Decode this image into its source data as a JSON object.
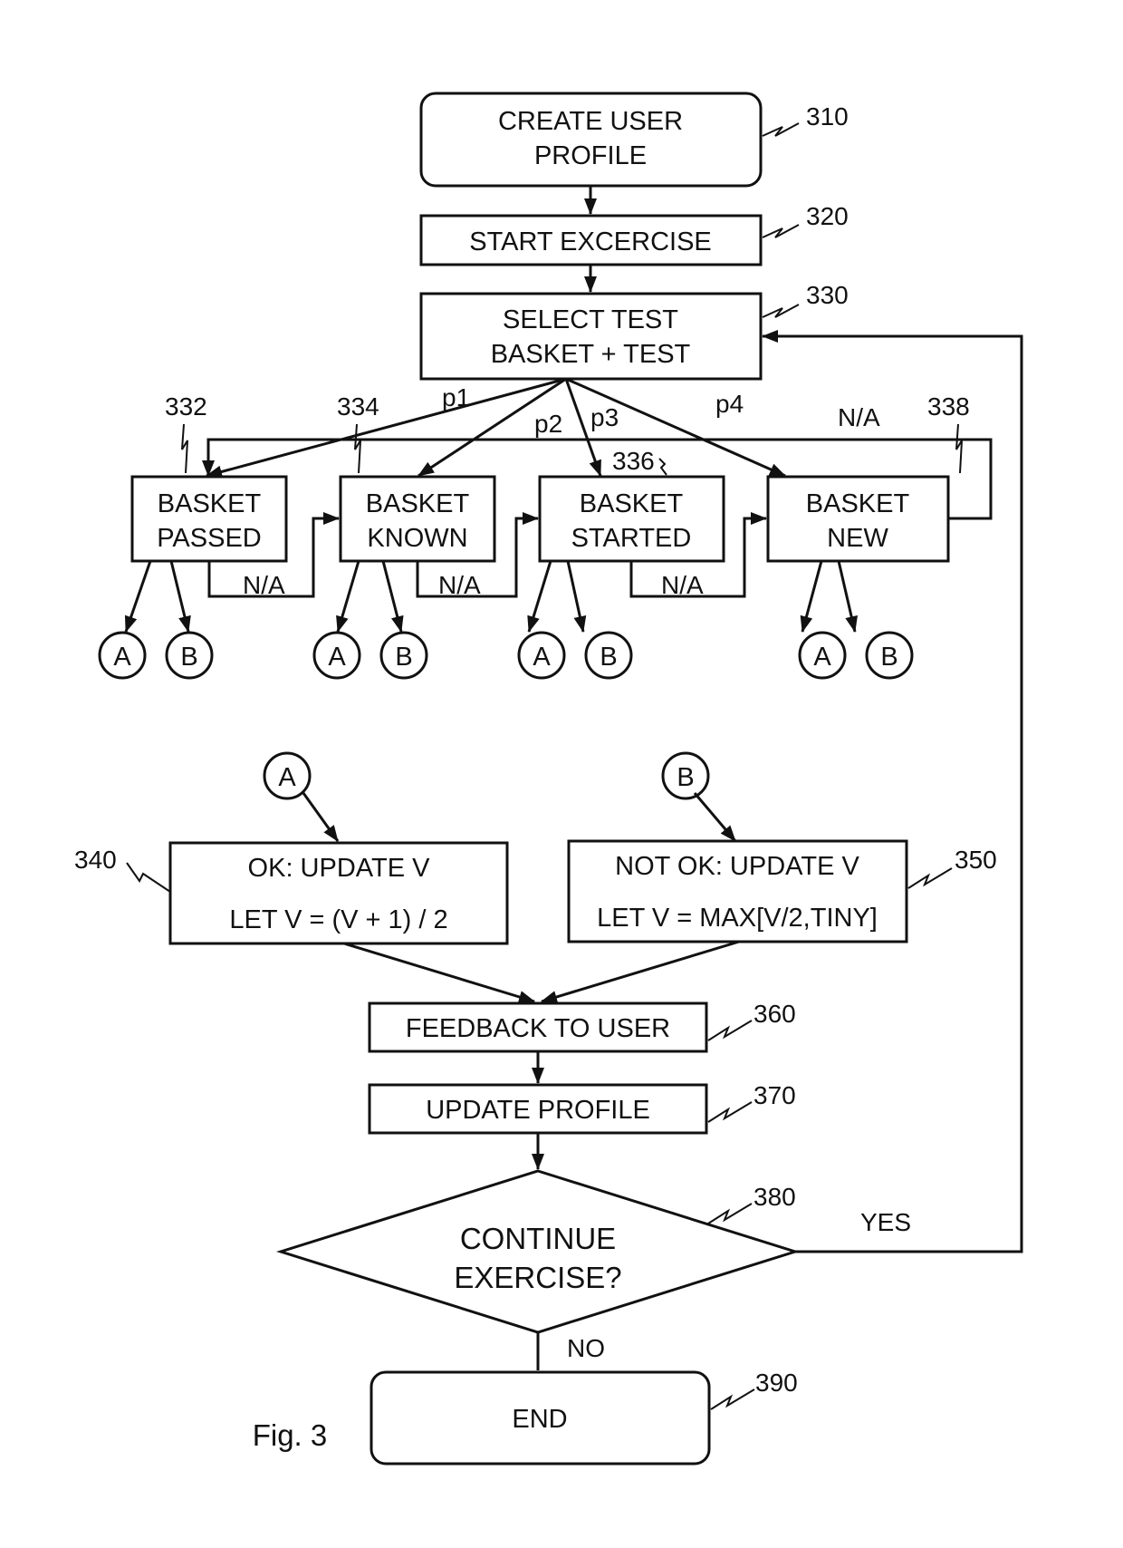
{
  "figure": {
    "caption": "Fig. 3",
    "colors": {
      "stroke": "#111111",
      "background": "#ffffff"
    }
  },
  "nodes": {
    "n310": {
      "ref": "310",
      "line1": "CREATE USER",
      "line2": "PROFILE"
    },
    "n320": {
      "ref": "320",
      "line1": "START EXCERCISE"
    },
    "n330": {
      "ref": "330",
      "line1": "SELECT TEST",
      "line2": "BASKET + TEST"
    },
    "n332": {
      "ref": "332",
      "line1": "BASKET",
      "line2": "PASSED"
    },
    "n334": {
      "ref": "334",
      "line1": "BASKET",
      "line2": "KNOWN"
    },
    "n336": {
      "ref": "336",
      "line1": "BASKET",
      "line2": "STARTED"
    },
    "n338": {
      "ref": "338",
      "line1": "BASKET",
      "line2": "NEW"
    },
    "n340": {
      "ref": "340",
      "line1": "OK: UPDATE V",
      "line2": "LET V = (V + 1) / 2"
    },
    "n350": {
      "ref": "350",
      "line1": "NOT OK: UPDATE V",
      "line2": "LET V = MAX[V/2,TINY]"
    },
    "n360": {
      "ref": "360",
      "line1": "FEEDBACK TO USER"
    },
    "n370": {
      "ref": "370",
      "line1": "UPDATE PROFILE"
    },
    "n380": {
      "ref": "380",
      "line1": "CONTINUE",
      "line2": "EXERCISE?"
    },
    "n390": {
      "ref": "390",
      "line1": "END"
    }
  },
  "edges": {
    "p1": "p1",
    "p2": "p2",
    "p3": "p3",
    "p4": "p4",
    "na": "N/A",
    "yes": "YES",
    "no": "NO"
  },
  "connectors": {
    "a": "A",
    "b": "B"
  }
}
